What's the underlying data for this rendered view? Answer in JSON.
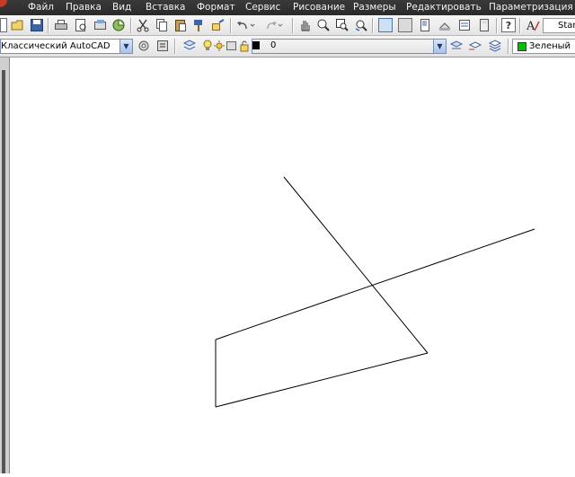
{
  "menu": {
    "items": [
      "Файл",
      "Правка",
      "Вид",
      "Вставка",
      "Формат",
      "Сервис",
      "Рисование",
      "Размеры",
      "Редактировать",
      "Параметризация"
    ]
  },
  "toolbar1": {
    "style_field": "Stan",
    "icons": [
      "new-icon",
      "open-icon",
      "save-icon",
      "print-icon",
      "plot-preview-icon",
      "publish-icon",
      "3d-dwf-icon",
      "cut-icon",
      "copy-icon",
      "paste-icon",
      "match-properties-icon",
      "block-editor-icon",
      "undo-icon",
      "redo-icon",
      "pan-icon",
      "zoom-realtime-icon",
      "zoom-window-icon",
      "zoom-previous-icon",
      "properties-icon",
      "design-center-icon",
      "tool-palettes-icon",
      "sheet-set-icon",
      "markup-icon",
      "calculator-icon",
      "help-icon",
      "text-style-icon"
    ]
  },
  "toolbar2": {
    "workspace": "Классический AutoCAD",
    "layer": "0",
    "color": "Зеленый",
    "color_swatch": "#00c000",
    "layer_swatch": "#000000"
  },
  "drawing": {
    "stroke": "#000000"
  }
}
